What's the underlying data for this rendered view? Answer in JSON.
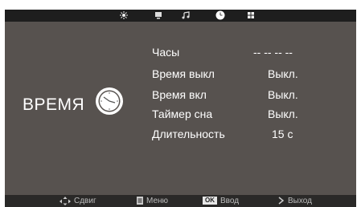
{
  "menubar": {
    "tabs": [
      {
        "icon": "picture-brightness-icon"
      },
      {
        "icon": "screen-icon"
      },
      {
        "icon": "music-note-icon"
      },
      {
        "icon": "clock-icon",
        "active": true
      },
      {
        "icon": "grid-icon"
      }
    ]
  },
  "section": {
    "title": "ВРЕМЯ",
    "icon": "clock-icon"
  },
  "menu": {
    "items": [
      {
        "label": "Часы",
        "value": "-- -- -- --"
      },
      {
        "label": "Время выкл",
        "value": "Выкл."
      },
      {
        "label": "Время вкл",
        "value": "Выкл."
      },
      {
        "label": "Таймер сна",
        "value": "Выкл."
      },
      {
        "label": "Длительность",
        "value": "15 с"
      }
    ]
  },
  "footer": {
    "navigate": {
      "icon": "arrows-icon",
      "label": "Сдвиг"
    },
    "menu": {
      "icon": "menu-icon",
      "label": "Меню"
    },
    "enter": {
      "badge": "OK",
      "label": "Ввод"
    },
    "exit": {
      "icon": "exit-icon",
      "label": "Выход"
    }
  },
  "colors": {
    "panel": "#57524f",
    "menubar": "#1e1e1e",
    "text": "#ffffff"
  }
}
